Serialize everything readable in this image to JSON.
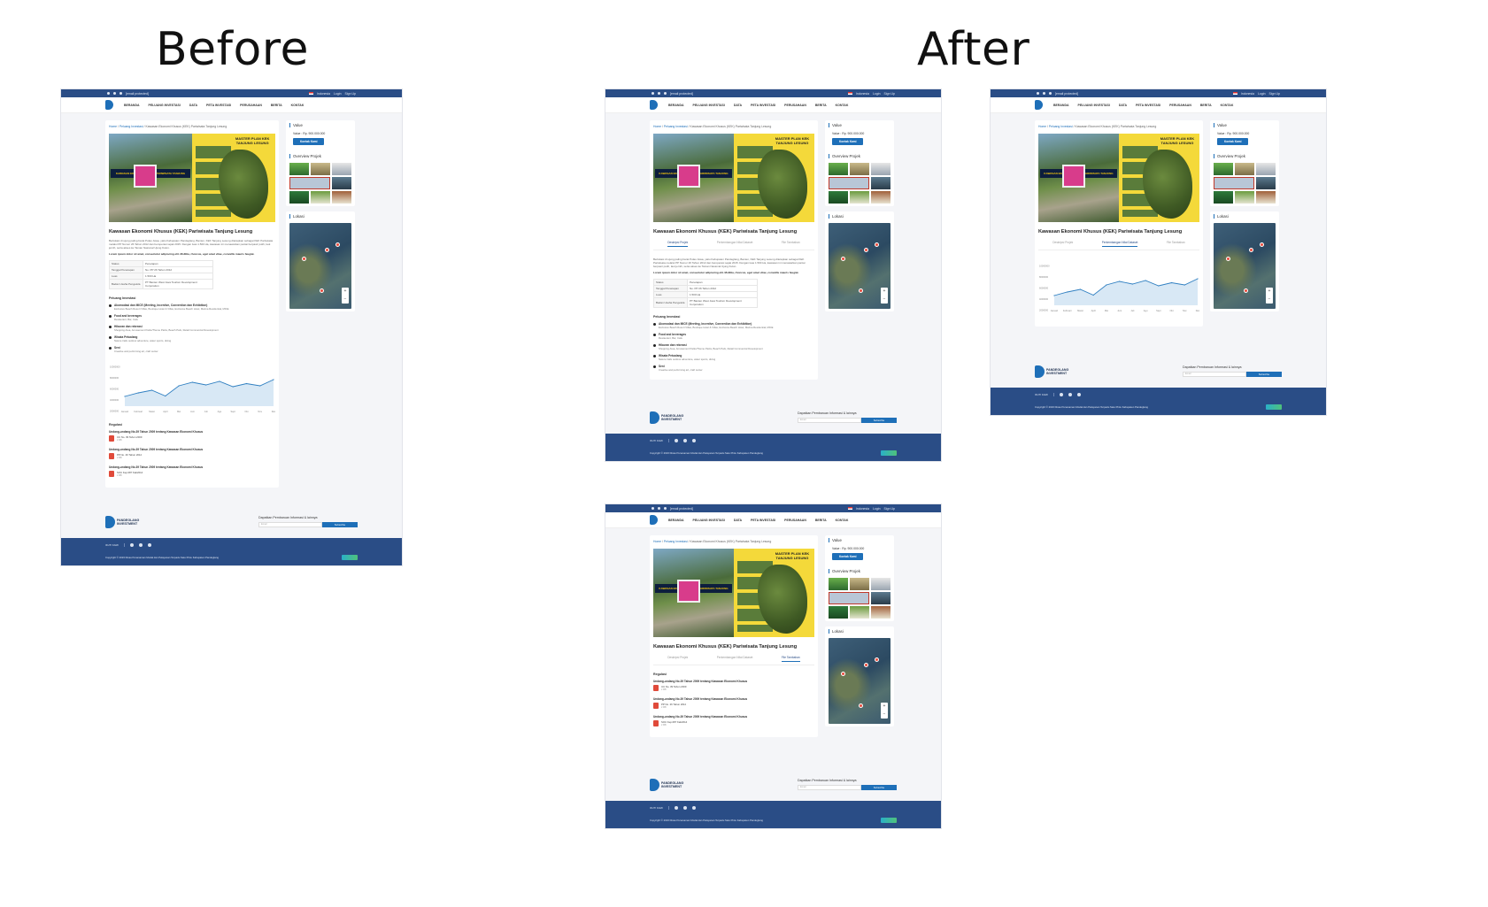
{
  "headings": {
    "before": "Before",
    "after": "After"
  },
  "topbar": {
    "email": "[email protected]",
    "lang": "Indonesia",
    "login": "Login",
    "signup": "Sign Up"
  },
  "nav": [
    "BERANDA",
    "PELUANG INVESTASI",
    "DATA",
    "PETA INVESTASI",
    "PERUSAHAAN",
    "BERITA",
    "KONTAK"
  ],
  "breadcrumb": {
    "home": "Home",
    "peluang": "Peluang Investasi",
    "current": "Kawasan Ekonomi Khusus (KEK) Pariwisata Tanjung Lesung"
  },
  "hero": {
    "plan_title": "MASTER PLAN KEK TANJUNG LESUNG",
    "banner": "KAWASAN EKONOMI KHUSUS PARIWISATA TANJUNG LESUNG"
  },
  "project": {
    "title": "Kawasan Ekonomi Khusus (KEK) Pariwisata Tanjung Lesung",
    "description": "Berlokasi di ujung paling barat Pulau Jawa, yaitu Kabupaten Pandeglang, Banten, KEK Tanjung Lesung ditetapkan sebagai KEK Pariwisata melalui PP Nomor 26 Tahun 2012 dan beroperasi sejak 2015. Dengan luas 1.500 Ha, kawasan ini menawarkan pantai berpasir putih, laut jernih, serta akses ke Taman Nasional Ujung Kulon.",
    "lorem": "Lorem ipsum dolor sit amet, consectetur adipiscing elit. Mollitia, rhoncus, eget amet vitae, convallis mauris feugiat.",
    "table": [
      {
        "k": "Status",
        "v": "Penetapan"
      },
      {
        "k": "Tanggal Penetapan",
        "v": "No. PP 26 Tahun 2012"
      },
      {
        "k": "Luas",
        "v": "1.500 Ha"
      },
      {
        "k": "Badan Usaha Pengelola",
        "v": "PT Banten West Java Tourism Development Corporation"
      }
    ]
  },
  "peluang": {
    "title": "Peluang Investasi",
    "items": [
      {
        "t": "Akomodasi dan MICE (Meeting, Incentive, Convention dan Exhibition)",
        "d": "Exclusive Beach Resort Villas, Boutique Hotel & Villas, Exclusive Beach Hotel, Marina Residential, MICE"
      },
      {
        "t": "Food and beverages",
        "d": "Restaurant, Bar, Cafe"
      },
      {
        "t": "Hiburan dan rekreasi",
        "d": "Shopping Area, Amusement Parks/Theme Parks, Beach Park, Retail Commercial Development"
      },
      {
        "t": "Wisata Petualang",
        "d": "Nature trails outdoor adventure, water sports, diving"
      },
      {
        "t": "Seni",
        "d": "Creative and performing art, craft center"
      }
    ]
  },
  "tabs": [
    "Deskripsi Projek",
    "Perkembangan Nilai Dataset",
    "File Tambahan"
  ],
  "regulasi": {
    "title": "Regulasi",
    "items": [
      {
        "t": "Undang-undang No.39 Tahun 2009 tentang Kawasan Ekonomi Khusus",
        "f": "UU No. 39 Tahun 2009",
        "s": "2 MB"
      },
      {
        "t": "Undang-undang No.39 Tahun 2009 tentang Kawasan Ekonomi Khusus",
        "f": "PP No. 26 Tahun 2012",
        "s": "2 MB"
      },
      {
        "t": "Undang-undang No.39 Tahun 2009 tentang Kawasan Ekonomi Khusus",
        "f": "SOU Kep.087 Kab2014",
        "s": "2 MB"
      }
    ]
  },
  "sidebar": {
    "value_title": "Value",
    "value_text": "Value : Rp. 900.000.000",
    "contact": "Kontak Kami",
    "overview_title": "Overview Projek",
    "lokasi_title": "Lokasi"
  },
  "footer": {
    "brand": "PANDEGLANG INVESTMENT",
    "newsletter_title": "Dapatkan Pembaruan Informasi & lainnya",
    "email_placeholder": "Email",
    "subscribe": "Subscribe",
    "ikuti": "IKUTI KAMI",
    "copyright": "Copyright © 2023 Dinas Penanaman Modal dan Pelayanan Terpadu Satu Pintu Kabupaten Pandeglang"
  },
  "chart_data": {
    "type": "line",
    "categories": [
      "Januari",
      "Februari",
      "Maret",
      "April",
      "Mei",
      "Juni",
      "Juli",
      "Agu",
      "Sept",
      "Okt",
      "Nov",
      "Des"
    ],
    "values": [
      2.2,
      3.0,
      3.6,
      2.3,
      4.6,
      5.4,
      4.8,
      5.6,
      4.4,
      5.1,
      4.6,
      6.0
    ],
    "yticks": [
      "10000000",
      "8000000",
      "6000000",
      "4000000",
      "2000000"
    ],
    "ylim": [
      0,
      10
    ],
    "colors": {
      "line": "#2f7fc1",
      "area": "#d8e8f5"
    }
  }
}
